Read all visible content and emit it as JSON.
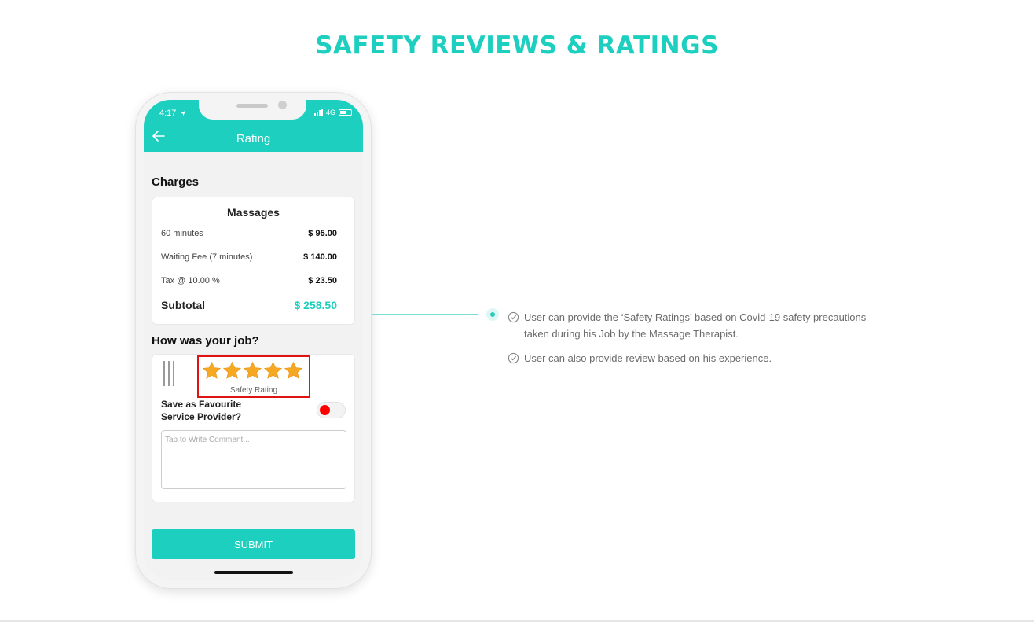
{
  "page": {
    "title": "SAFETY REVIEWS & RATINGS"
  },
  "colors": {
    "accent": "#1ccfbe",
    "highlight": "#e01313",
    "star": "#f7a823",
    "toggle_knob": "#ff0000"
  },
  "phone": {
    "status_bar": {
      "time": "4:17",
      "network": "4G",
      "icons": [
        "location-arrow-icon",
        "signal-icon",
        "battery-icon"
      ]
    },
    "header": {
      "back_icon": "arrow-left-icon",
      "title": "Rating"
    },
    "charges": {
      "section_title": "Charges",
      "card_title": "Massages",
      "rows": [
        {
          "label": "60 minutes",
          "amount": "$ 95.00"
        },
        {
          "label": "Waiting Fee (7 minutes)",
          "amount": "$ 140.00"
        },
        {
          "label": "Tax @ 10.00 %",
          "amount": "$ 23.50"
        }
      ],
      "subtotal_label": "Subtotal",
      "subtotal_amount": "$ 258.50"
    },
    "review": {
      "section_title": "How was your job?",
      "rating": {
        "stars": 5,
        "max": 5,
        "caption": "Safety Rating"
      },
      "favourite_label_line1": "Save as Favourite",
      "favourite_label_line2": "Service Provider?",
      "favourite_toggle": "off",
      "comment_placeholder": "Tap to Write Comment..."
    },
    "submit_label": "SUBMIT"
  },
  "features": [
    {
      "text_line1": "User can provide the ‘Safety Ratings’ based on Covid-19 safety precautions",
      "text_line2": "taken during his Job by the Massage Therapist."
    },
    {
      "text_line1": "User can also provide review based on his experience.",
      "text_line2": ""
    }
  ]
}
